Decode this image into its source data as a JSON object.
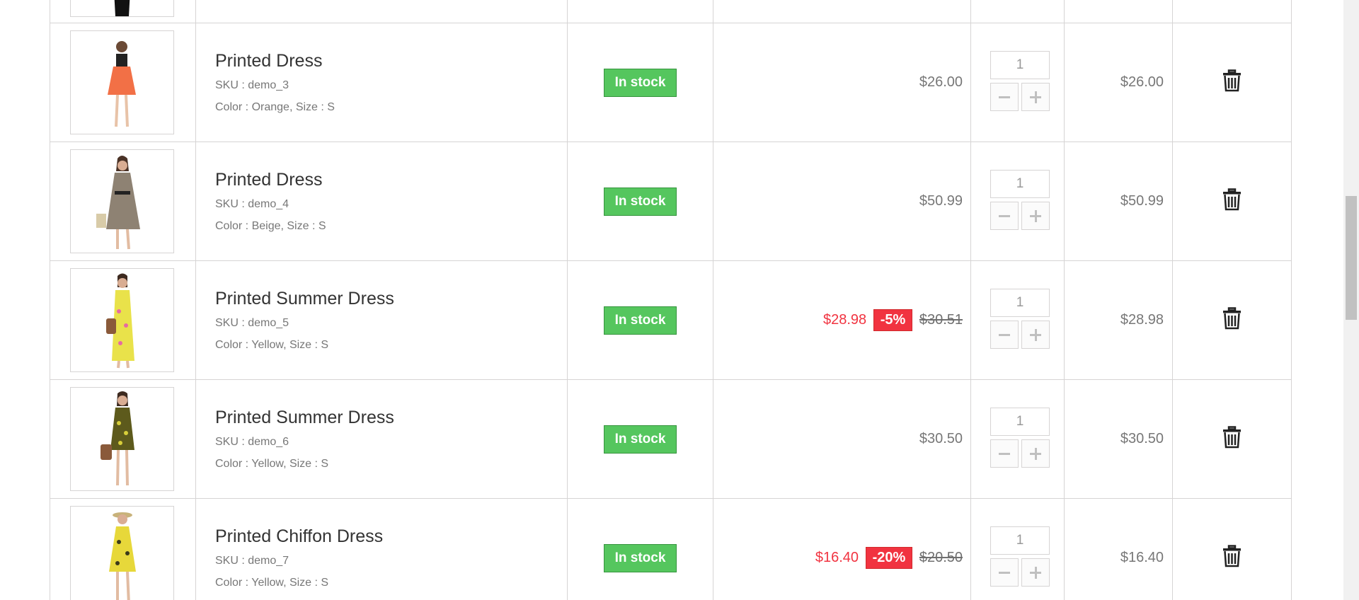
{
  "cart": {
    "rows": [
      {
        "name": "Printed Dress",
        "sku": "SKU : demo_3",
        "attributes": "Color : Orange, Size : S",
        "availability": "In stock",
        "unit_price": "$26.00",
        "quantity": "1",
        "total": "$26.00",
        "dress_color": "#f27046"
      },
      {
        "name": "Printed Dress",
        "sku": "SKU : demo_4",
        "attributes": "Color : Beige, Size : S",
        "availability": "In stock",
        "unit_price": "$50.99",
        "quantity": "1",
        "total": "$50.99",
        "dress_color": "#8e8273"
      },
      {
        "name": "Printed Summer Dress",
        "sku": "SKU : demo_5",
        "attributes": "Color : Yellow, Size : S",
        "availability": "In stock",
        "special_price": "$28.98",
        "discount": "-5%",
        "old_price": "$30.51",
        "quantity": "1",
        "total": "$28.98",
        "dress_color": "#e9e24a"
      },
      {
        "name": "Printed Summer Dress",
        "sku": "SKU : demo_6",
        "attributes": "Color : Yellow, Size : S",
        "availability": "In stock",
        "unit_price": "$30.50",
        "quantity": "1",
        "total": "$30.50",
        "dress_color": "#5d5a1c"
      },
      {
        "name": "Printed Chiffon Dress",
        "sku": "SKU : demo_7",
        "attributes": "Color : Yellow, Size : S",
        "availability": "In stock",
        "special_price": "$16.40",
        "discount": "-20%",
        "old_price": "$20.50",
        "quantity": "1",
        "total": "$16.40",
        "dress_color": "#e7d83a"
      }
    ]
  },
  "colors": {
    "in_stock": "#55c65e",
    "special_price": "#f13340",
    "border": "#d6d4d4"
  },
  "icons": {
    "delete": "trash-icon",
    "decrease": "minus-icon",
    "increase": "plus-icon"
  }
}
